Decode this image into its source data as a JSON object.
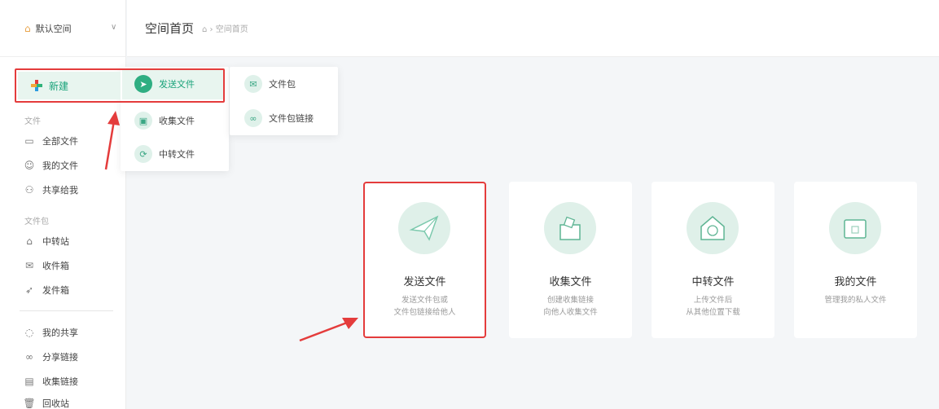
{
  "sidebar": {
    "space_label": "默认空间",
    "new_label": "新建",
    "section_files": "文件",
    "section_packages": "文件包",
    "items_files": [
      {
        "label": "全部文件",
        "icon": "folder-icon"
      },
      {
        "label": "我的文件",
        "icon": "user-icon"
      },
      {
        "label": "共享给我",
        "icon": "share-icon"
      }
    ],
    "items_packages": [
      {
        "label": "中转站",
        "icon": "transfer-icon"
      },
      {
        "label": "收件箱",
        "icon": "inbox-icon"
      },
      {
        "label": "发件箱",
        "icon": "send-icon"
      }
    ],
    "items_bottom": [
      {
        "label": "我的共享",
        "icon": "share-circle-icon"
      },
      {
        "label": "分享链接",
        "icon": "link-icon"
      },
      {
        "label": "收集链接",
        "icon": "collect-icon"
      },
      {
        "label": "回收站",
        "icon": "trash-icon"
      }
    ]
  },
  "header": {
    "title": "空间首页",
    "breadcrumb": "空间首页"
  },
  "new_menu": {
    "col1": [
      "发送文件",
      "收集文件",
      "中转文件"
    ],
    "col2": [
      "文件包",
      "文件包链接"
    ]
  },
  "cards": [
    {
      "title": "发送文件",
      "desc1": "发送文件包或",
      "desc2": "文件包链接给他人"
    },
    {
      "title": "收集文件",
      "desc1": "创建收集链接",
      "desc2": "向他人收集文件"
    },
    {
      "title": "中转文件",
      "desc1": "上传文件后",
      "desc2": "从其他位置下载"
    },
    {
      "title": "我的文件",
      "desc1": "管理我的私人文件",
      "desc2": ""
    }
  ],
  "colors": {
    "accent": "#2fae82",
    "highlight": "#e43c3c"
  }
}
